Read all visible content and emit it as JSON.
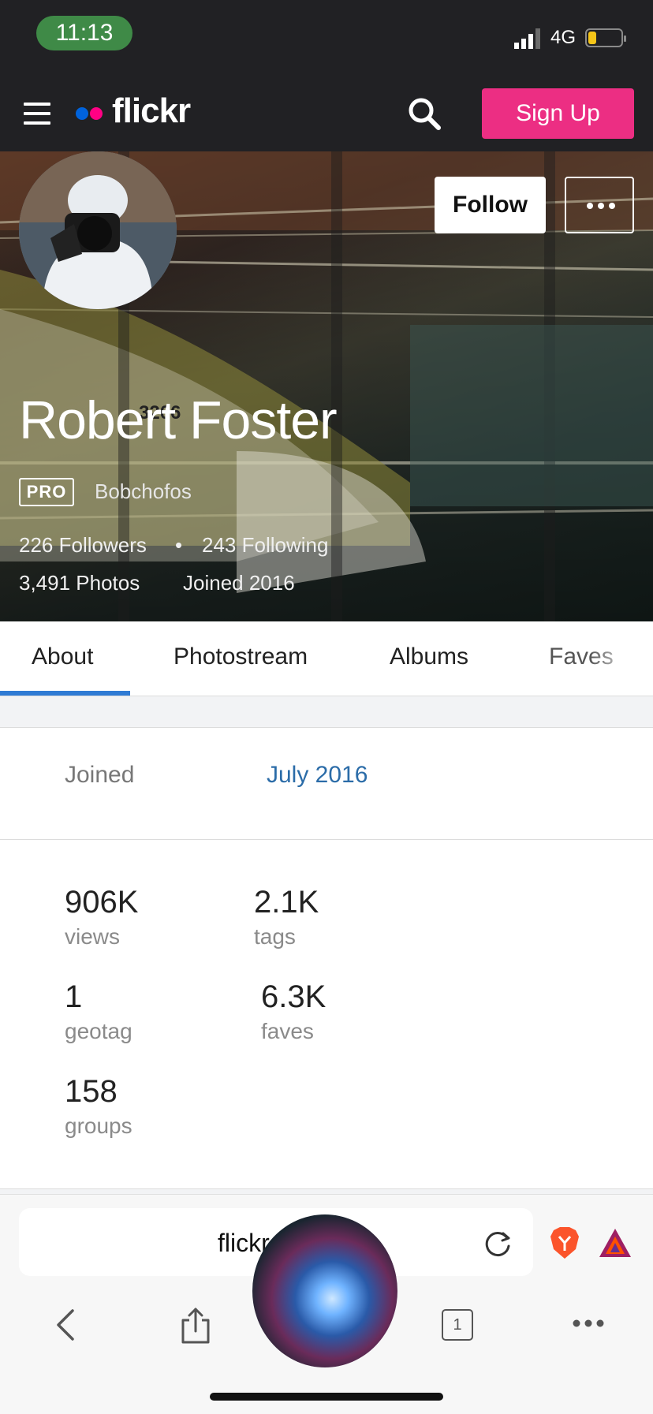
{
  "status_bar": {
    "time": "11:13",
    "network": "4G",
    "battery_level": 0.25
  },
  "header": {
    "logo_text": "flickr",
    "signup_label": "Sign Up",
    "colors": {
      "dot_blue": "#0063dc",
      "dot_pink": "#ff0084",
      "signup": "#ec2e83"
    }
  },
  "profile": {
    "name": "Robert Foster",
    "pro_badge": "PRO",
    "username": "Bobchofos",
    "followers": "226 Followers",
    "separator": "•",
    "following": "243 Following",
    "photos": "3,491 Photos",
    "joined": "Joined 2016",
    "follow_label": "Follow",
    "hero_number": "3206"
  },
  "tabs": [
    {
      "label": "About",
      "active": true
    },
    {
      "label": "Photostream"
    },
    {
      "label": "Albums"
    },
    {
      "label": "Faves"
    }
  ],
  "about": {
    "joined_label": "Joined",
    "joined_value": "July 2016",
    "stats": [
      {
        "value": "906K",
        "label": "views"
      },
      {
        "value": "2.1K",
        "label": "tags"
      },
      {
        "value": "1",
        "label": "geotag"
      },
      {
        "value": "6.3K",
        "label": "faves"
      },
      {
        "value": "158",
        "label": "groups"
      }
    ]
  },
  "browser": {
    "url": "flickr",
    "tab_count": "1"
  }
}
